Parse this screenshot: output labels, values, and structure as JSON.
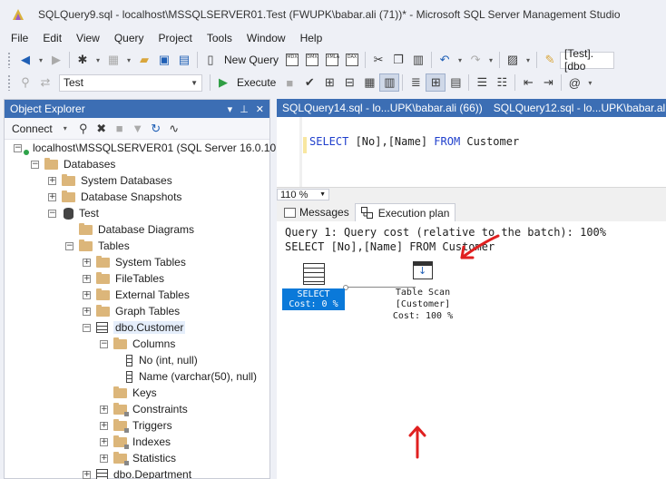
{
  "window": {
    "title": "SQLQuery9.sql - localhost\\MSSQLSERVER01.Test (FWUPK\\babar.ali (71))* - Microsoft SQL Server Management Studio"
  },
  "menu": [
    "File",
    "Edit",
    "View",
    "Query",
    "Project",
    "Tools",
    "Window",
    "Help"
  ],
  "toolbar": {
    "new_query_label": "New Query",
    "mdx_label": "MDX",
    "dmx_label": "DMX",
    "xmla_label": "XMLA",
    "dax_label": "DAX",
    "database_dropdown": "Test",
    "execute_label": "Execute",
    "right_dropdown": "[Test].[dbo"
  },
  "object_explorer": {
    "title": "Object Explorer",
    "connect_label": "Connect",
    "pin_glyph": "▾ ⊥ ✕",
    "nodes": [
      {
        "label": "localhost\\MSSQLSERVER01 (SQL Server 16.0.10"
      },
      {
        "label": "Databases"
      },
      {
        "label": "System Databases"
      },
      {
        "label": "Database Snapshots"
      },
      {
        "label": "Test"
      },
      {
        "label": "Database Diagrams"
      },
      {
        "label": "Tables"
      },
      {
        "label": "System Tables"
      },
      {
        "label": "FileTables"
      },
      {
        "label": "External Tables"
      },
      {
        "label": "Graph Tables"
      },
      {
        "label": "dbo.Customer"
      },
      {
        "label": "Columns"
      },
      {
        "label": "No (int, null)"
      },
      {
        "label": "Name (varchar(50), null)"
      },
      {
        "label": "Keys"
      },
      {
        "label": "Constraints"
      },
      {
        "label": "Triggers"
      },
      {
        "label": "Indexes"
      },
      {
        "label": "Statistics"
      },
      {
        "label": "dbo.Department"
      }
    ]
  },
  "editor": {
    "tab_active": "SQLQuery14.sql - lo...UPK\\babar.ali (66))",
    "tab_inactive": "SQLQuery12.sql - lo...UPK\\babar.ali (71)",
    "code": {
      "select_kw": "SELECT",
      "columns": " [No],[Name] ",
      "from_kw": "FROM",
      "table": " Customer"
    },
    "zoom": "110 %",
    "result_tabs": {
      "messages": "Messages",
      "execution_plan": "Execution plan"
    },
    "plan": {
      "query_cost_line": "Query 1: Query cost (relative to the batch): 100%",
      "statement_line": "SELECT [No],[Name] FROM Customer",
      "select_node": {
        "name": "SELECT",
        "cost": "Cost: 0 %"
      },
      "scan_node": {
        "name": "Table Scan",
        "object": "[Customer]",
        "cost": "Cost: 100 %"
      }
    }
  },
  "colors": {
    "header_blue": "#3c6eb4",
    "annotation_red": "#e02020",
    "select_blue": "#0a79d9"
  }
}
